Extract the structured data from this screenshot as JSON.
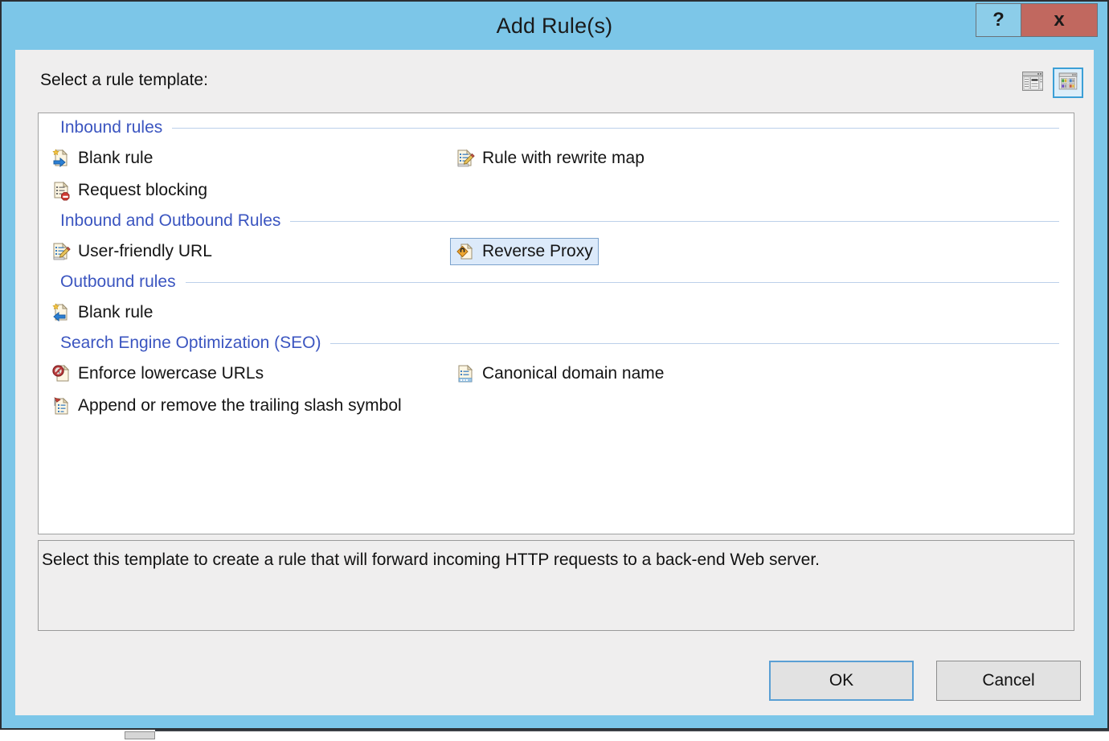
{
  "window": {
    "title": "Add Rule(s)",
    "help_label": "?",
    "close_label": "x",
    "frame_color": "#7cc6e8",
    "close_color": "#c1685f"
  },
  "prompt": {
    "label": "Select a rule template:"
  },
  "view_toggles": [
    {
      "name": "details-view",
      "selected": false
    },
    {
      "name": "tiles-view",
      "selected": true
    }
  ],
  "sections": [
    {
      "title": "Inbound rules",
      "items": [
        {
          "label": "Blank rule",
          "icon": "blank-inbound-rule-icon",
          "column": "left",
          "selected": false
        },
        {
          "label": "Rule with rewrite map",
          "icon": "rewrite-map-rule-icon",
          "column": "right",
          "selected": false
        },
        {
          "label": "Request blocking",
          "icon": "request-blocking-icon",
          "column": "left",
          "selected": false
        }
      ]
    },
    {
      "title": "Inbound and Outbound Rules",
      "items": [
        {
          "label": "User-friendly URL",
          "icon": "user-friendly-url-icon",
          "column": "left",
          "selected": false
        },
        {
          "label": "Reverse Proxy",
          "icon": "reverse-proxy-icon",
          "column": "right",
          "selected": true
        }
      ]
    },
    {
      "title": "Outbound rules",
      "items": [
        {
          "label": "Blank rule",
          "icon": "blank-outbound-rule-icon",
          "column": "left",
          "selected": false
        }
      ]
    },
    {
      "title": "Search Engine Optimization (SEO)",
      "items": [
        {
          "label": "Enforce lowercase URLs",
          "icon": "enforce-lowercase-icon",
          "column": "left",
          "selected": false
        },
        {
          "label": "Canonical domain name",
          "icon": "canonical-domain-icon",
          "column": "right",
          "selected": false
        },
        {
          "label": "Append or remove the trailing slash symbol",
          "icon": "trailing-slash-icon",
          "column": "left",
          "selected": false
        }
      ]
    }
  ],
  "description": {
    "text": "Select this template to create a rule that will forward incoming HTTP requests to a back-end Web server."
  },
  "footer": {
    "ok_label": "OK",
    "cancel_label": "Cancel"
  },
  "colors": {
    "section_header": "#3b55c0",
    "selection_bg": "#dceafa",
    "selection_border": "#7ba2cc",
    "accent": "#3b9fd6"
  }
}
